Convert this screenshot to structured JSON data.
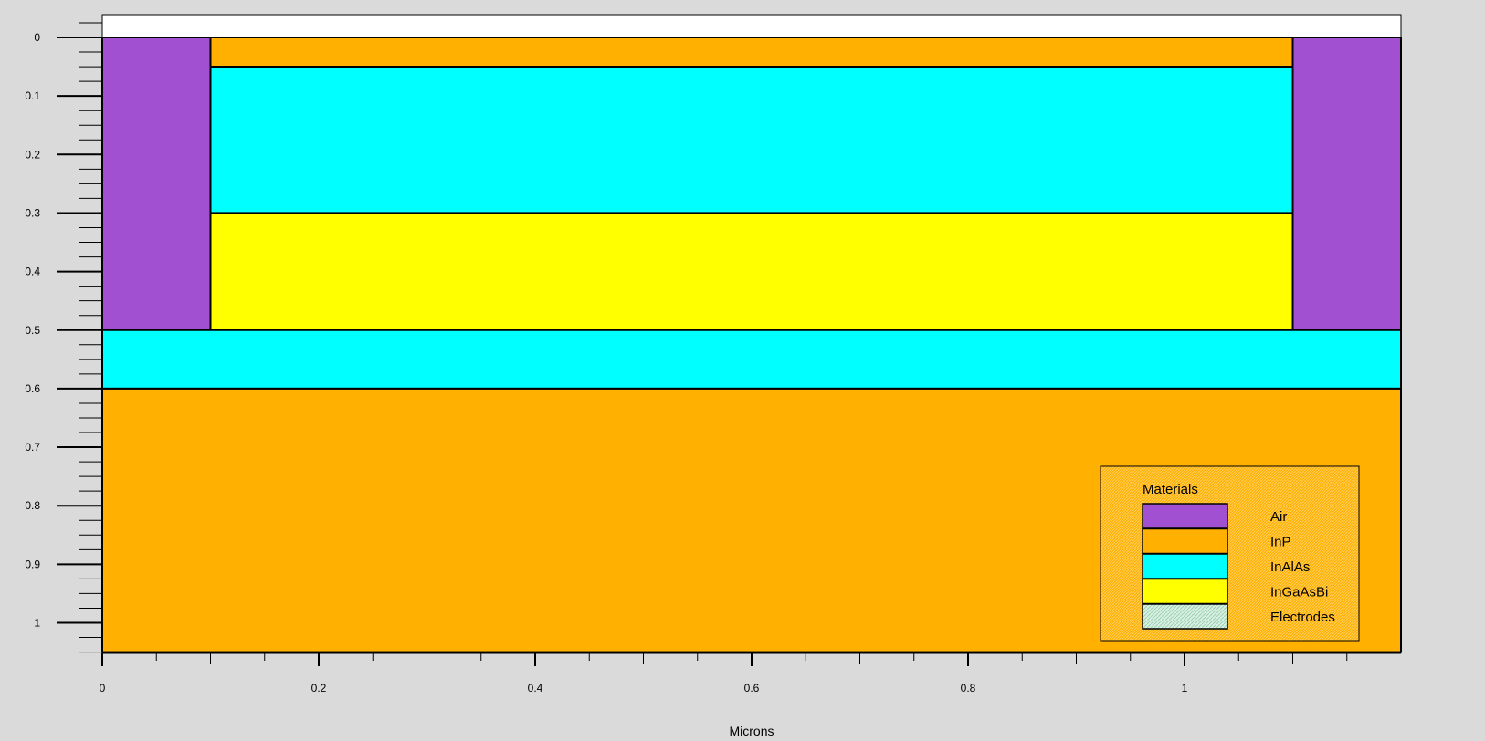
{
  "background_color": "#dadada",
  "x_axis_label": "Microns",
  "legend": {
    "title": "Materials",
    "entries": [
      {
        "name": "Air",
        "color": "#a050d0"
      },
      {
        "name": "InP",
        "color": "#ffb000"
      },
      {
        "name": "InAlAs",
        "color": "#00ffff"
      },
      {
        "name": "InGaAsBi",
        "color": "#ffff00"
      },
      {
        "name": "Electrodes",
        "color": "#bfe3d2",
        "pattern": "hatched"
      }
    ]
  },
  "chart_data": {
    "type": "device-structure",
    "xlabel": "Microns",
    "ylabel": "",
    "xlim": [
      0,
      1.2
    ],
    "ylim": [
      -0.04,
      1.05
    ],
    "y_inverted": true,
    "x_ticks": [
      {
        "value": 0,
        "label": "0"
      },
      {
        "value": 0.2,
        "label": "0.2"
      },
      {
        "value": 0.4,
        "label": "0.4"
      },
      {
        "value": 0.6,
        "label": "0.6"
      },
      {
        "value": 0.8,
        "label": "0.8"
      },
      {
        "value": 1,
        "label": "1"
      }
    ],
    "y_ticks": [
      {
        "value": 0,
        "label": "0"
      },
      {
        "value": 0.1,
        "label": "0.1"
      },
      {
        "value": 0.2,
        "label": "0.2"
      },
      {
        "value": 0.3,
        "label": "0.3"
      },
      {
        "value": 0.4,
        "label": "0.4"
      },
      {
        "value": 0.5,
        "label": "0.5"
      },
      {
        "value": 0.6,
        "label": "0.6"
      },
      {
        "value": 0.7,
        "label": "0.7"
      },
      {
        "value": 0.8,
        "label": "0.8"
      },
      {
        "value": 0.9,
        "label": "0.9"
      },
      {
        "value": 1,
        "label": "1"
      }
    ],
    "regions": [
      {
        "material": "Air",
        "x": [
          0,
          0.1
        ],
        "y": [
          0,
          0.5
        ],
        "color": "#a050d0"
      },
      {
        "material": "Air",
        "x": [
          1.1,
          1.2
        ],
        "y": [
          0,
          0.5
        ],
        "color": "#a050d0"
      },
      {
        "material": "InP",
        "x": [
          0.1,
          1.1
        ],
        "y": [
          0,
          0.05
        ],
        "color": "#ffb000"
      },
      {
        "material": "InAlAs",
        "x": [
          0.1,
          1.1
        ],
        "y": [
          0.05,
          0.3
        ],
        "color": "#00ffff"
      },
      {
        "material": "InGaAsBi",
        "x": [
          0.1,
          1.1
        ],
        "y": [
          0.3,
          0.5
        ],
        "color": "#ffff00"
      },
      {
        "material": "InAlAs",
        "x": [
          0,
          1.2
        ],
        "y": [
          0.5,
          0.6
        ],
        "color": "#00ffff"
      },
      {
        "material": "InP",
        "x": [
          0,
          1.2
        ],
        "y": [
          0.6,
          1.05
        ],
        "color": "#ffb000"
      }
    ]
  }
}
